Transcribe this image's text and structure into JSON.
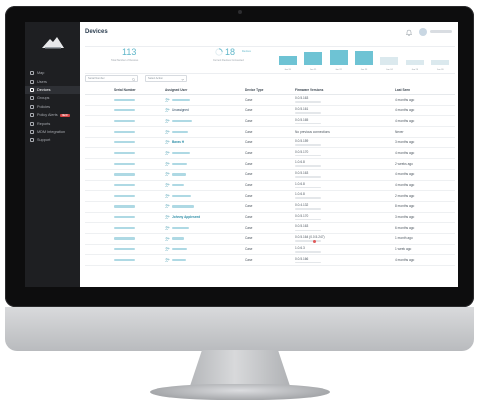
{
  "sidebar": {
    "items": [
      {
        "label": "Map",
        "icon": "map-icon"
      },
      {
        "label": "Users",
        "icon": "users-icon"
      },
      {
        "label": "Devices",
        "icon": "devices-icon",
        "active": true
      },
      {
        "label": "Groups",
        "icon": "groups-icon"
      },
      {
        "label": "Policies",
        "icon": "policies-icon"
      },
      {
        "label": "Policy Alerts",
        "icon": "alerts-icon",
        "badge": "NEW"
      },
      {
        "label": "Reports",
        "icon": "reports-icon"
      },
      {
        "label": "MDM Integration",
        "icon": "mdm-icon"
      },
      {
        "label": "Support",
        "icon": "support-icon"
      }
    ]
  },
  "header": {
    "title": "Devices"
  },
  "stats": {
    "total_value": "113",
    "total_label": "Total Number of Devices",
    "current_value": "18",
    "current_sub": "Devices",
    "current_label": "Current Devices Connected"
  },
  "bar_chart": {
    "labels": [
      "Jan 20",
      "Jan 21",
      "Jan 22",
      "Jan 23",
      "Jan 24",
      "Jan 25",
      "Jan 26"
    ],
    "values": [
      0.5,
      0.7,
      0.85,
      0.8,
      0.45,
      0.3,
      0.3
    ],
    "filled": [
      true,
      true,
      true,
      true,
      false,
      false,
      false
    ]
  },
  "filters": {
    "search_placeholder": "Serial Number",
    "action_placeholder": "Select Action"
  },
  "table": {
    "columns": [
      "Serial Number",
      "Assigned User",
      "Device Type",
      "Firmware Versions",
      "Last Seen"
    ],
    "rows": [
      {
        "user": "",
        "type": "Case",
        "fw": "0.0.5.163",
        "seen": "4 months ago"
      },
      {
        "user": "Unassigned",
        "type": "Case",
        "fw": "0.0.5.161",
        "seen": "4 months ago"
      },
      {
        "user": "",
        "type": "Case",
        "fw": "0.0.5.165",
        "seen": "4 months ago"
      },
      {
        "user": "",
        "type": "Case",
        "fw": "No previous connections",
        "seen": "Never"
      },
      {
        "user": "Baras H",
        "type": "Case",
        "fw": "0.0.5.159",
        "seen": "3 months ago"
      },
      {
        "user": "",
        "type": "Case",
        "fw": "0.0.5.170",
        "seen": "4 months ago"
      },
      {
        "user": "",
        "type": "Case",
        "fw": "1.0.6.8",
        "seen": "2 weeks ago"
      },
      {
        "user": "",
        "type": "Case",
        "fw": "0.0.5.163",
        "seen": "4 months ago"
      },
      {
        "user": "",
        "type": "Case",
        "fw": "1.0.6.8",
        "seen": "4 months ago"
      },
      {
        "user": "",
        "type": "Case",
        "fw": "1.0.6.8",
        "seen": "2 months ago"
      },
      {
        "user": "",
        "type": "Case",
        "fw": "0.0.4.132",
        "seen": "8 months ago"
      },
      {
        "user": "Johnny Appleseed",
        "type": "Case",
        "fw": "0.0.5.170",
        "seen": "3 months ago"
      },
      {
        "user": "",
        "type": "Case",
        "fw": "0.0.5.163",
        "seen": "6 months ago"
      },
      {
        "user": "",
        "type": "Case",
        "fw": "0.0.5.164 (0.0.5.247)",
        "seen": "1 month ago"
      },
      {
        "user": "",
        "type": "Case",
        "fw": "1.0.6.3",
        "seen": "1 week ago"
      },
      {
        "user": "",
        "type": "Case",
        "fw": "0.0.5.166",
        "seen": "4 months ago"
      }
    ]
  }
}
